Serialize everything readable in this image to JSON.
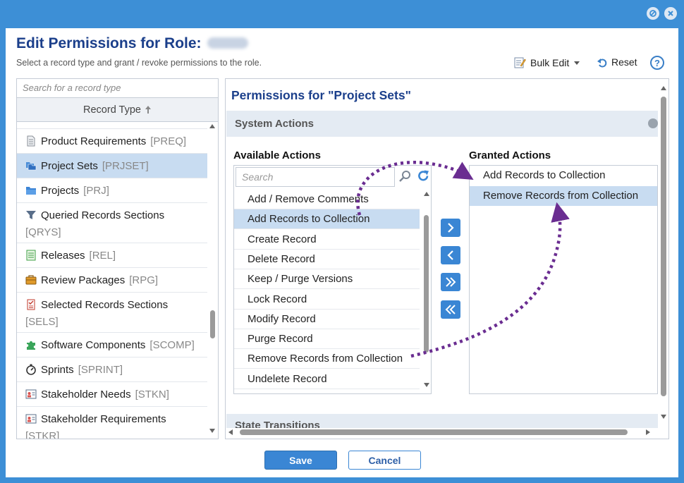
{
  "dialog": {
    "title": "Edit Permissions for Role:",
    "subtitle": "Select a record type and grant / revoke permissions to the role."
  },
  "toolbar": {
    "bulk_edit": "Bulk Edit",
    "reset": "Reset",
    "help": "?"
  },
  "record_types": {
    "search_placeholder": "Search for a record type",
    "header": "Record Type",
    "items": [
      {
        "name": "Product Requirements",
        "code": "[PREQ]",
        "icon": "document-icon",
        "selected": false
      },
      {
        "name": "Project Sets",
        "code": "[PRJSET]",
        "icon": "folders-icon",
        "selected": true
      },
      {
        "name": "Projects",
        "code": "[PRJ]",
        "icon": "folder-icon",
        "selected": false
      },
      {
        "name": "Queried Records Sections",
        "code": "[QRYS]",
        "icon": "filter-icon",
        "selected": false
      },
      {
        "name": "Releases",
        "code": "[REL]",
        "icon": "list-icon",
        "selected": false
      },
      {
        "name": "Review Packages",
        "code": "[RPG]",
        "icon": "briefcase-icon",
        "selected": false
      },
      {
        "name": "Selected Records Sections",
        "code": "[SELS]",
        "icon": "checklist-icon",
        "selected": false
      },
      {
        "name": "Software Components",
        "code": "[SCOMP]",
        "icon": "puzzle-icon",
        "selected": false
      },
      {
        "name": "Sprints",
        "code": "[SPRINT]",
        "icon": "stopwatch-icon",
        "selected": false
      },
      {
        "name": "Stakeholder Needs",
        "code": "[STKN]",
        "icon": "id-card-icon",
        "selected": false
      },
      {
        "name": "Stakeholder Requirements",
        "code": "[STKR]",
        "icon": "id-card-icon",
        "selected": false
      }
    ]
  },
  "permissions": {
    "title": "Permissions for \"Project Sets\"",
    "system_actions_label": "System Actions",
    "state_transitions_label": "State Transitions",
    "available_title": "Available Actions",
    "granted_title": "Granted Actions",
    "search_placeholder": "Search",
    "available": [
      "Add / Remove Comments",
      "Add Records to Collection",
      "Create Record",
      "Delete Record",
      "Keep / Purge Versions",
      "Lock Record",
      "Modify Record",
      "Purge Record",
      "Remove Records from Collection",
      "Undelete Record"
    ],
    "available_selected_index": 1,
    "granted": [
      "Add Records to Collection",
      "Remove Records from Collection"
    ],
    "granted_selected_index": 1
  },
  "footer": {
    "save": "Save",
    "cancel": "Cancel"
  },
  "colors": {
    "frame": "#3d8fd6",
    "title": "#1b3f8b",
    "selection": "#c8dcf1",
    "button": "#3a86d4",
    "annotation_arrow": "#6a2d91"
  }
}
